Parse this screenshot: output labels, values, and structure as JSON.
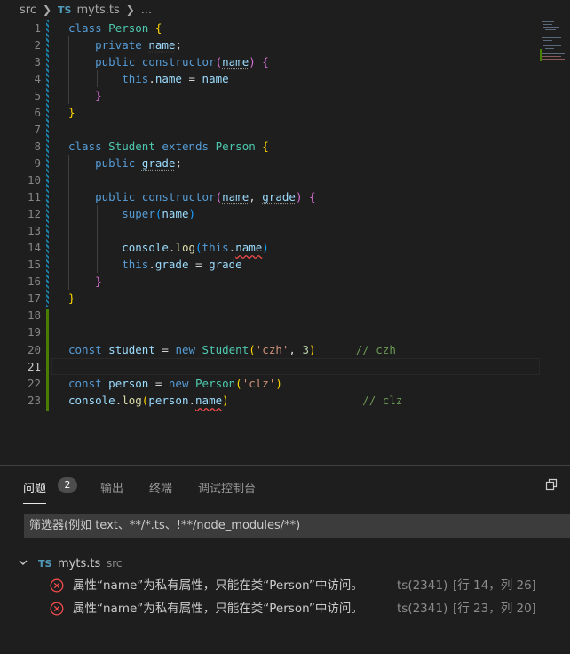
{
  "breadcrumb": {
    "folder": "src",
    "file_badge": "TS",
    "file": "myts.ts",
    "more": "..."
  },
  "editor": {
    "lines": [
      {
        "n": "1"
      },
      {
        "n": "2"
      },
      {
        "n": "3"
      },
      {
        "n": "4"
      },
      {
        "n": "5"
      },
      {
        "n": "6"
      },
      {
        "n": "7"
      },
      {
        "n": "8"
      },
      {
        "n": "9"
      },
      {
        "n": "10"
      },
      {
        "n": "11"
      },
      {
        "n": "12"
      },
      {
        "n": "13"
      },
      {
        "n": "14"
      },
      {
        "n": "15"
      },
      {
        "n": "16"
      },
      {
        "n": "17"
      },
      {
        "n": "18"
      },
      {
        "n": "19"
      },
      {
        "n": "20"
      },
      {
        "n": "21"
      },
      {
        "n": "22"
      },
      {
        "n": "23"
      }
    ],
    "tokens": {
      "class": "class",
      "person": "Person",
      "lbrace": "{",
      "rbrace": "}",
      "private": "private",
      "public": "public",
      "constructor": "constructor",
      "name": "name",
      "grade": "grade",
      "this": "this",
      "semicolon": ";",
      "lparen": "(",
      "rparen": ")",
      "dot": ".",
      "eq": " = ",
      "comma": ", ",
      "student": "Student",
      "extends": "extends",
      "super": "super",
      "console": "console",
      "log": "log",
      "const": "const",
      "new": "new",
      "student_var": "student",
      "person_var": "person",
      "str_czh": "'czh'",
      "num_3": "3",
      "str_clz": "'clz'",
      "comment_czh": "// czh",
      "comment_clz": "// clz"
    }
  },
  "panel": {
    "tabs": [
      {
        "label": "问题"
      },
      {
        "label": "输出"
      },
      {
        "label": "终端"
      },
      {
        "label": "调试控制台"
      }
    ],
    "problem_count": "2",
    "filter_placeholder": "筛选器(例如 text、**/*.ts、!**/node_modules/**)",
    "file_group": {
      "badge": "TS",
      "file": "myts.ts",
      "dir": "src"
    },
    "problems": [
      {
        "message": "属性“name”为私有属性，只能在类“Person”中访问。",
        "source": "ts(2341)",
        "position": "[行 14，列 26]"
      },
      {
        "message": "属性“name”为私有属性，只能在类“Person”中访问。",
        "source": "ts(2341)",
        "position": "[行 23，列 20]"
      }
    ]
  },
  "colors": {
    "error": "#f14c4c",
    "keyword": "#569cd6",
    "type": "#4ec9b0",
    "string": "#ce9178",
    "comment": "#6a9955"
  }
}
